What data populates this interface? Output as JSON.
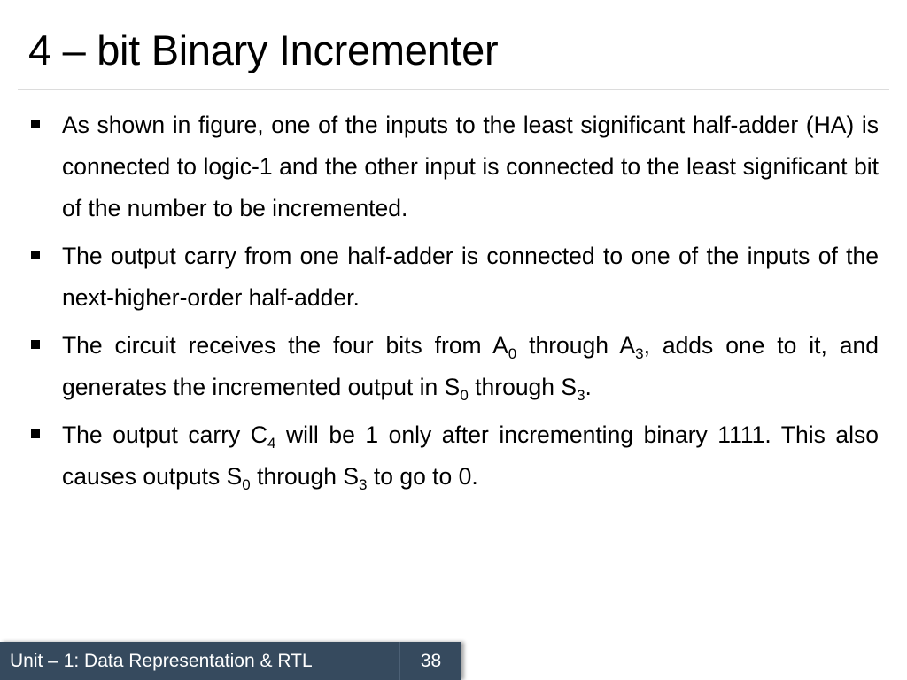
{
  "slide": {
    "title": "4 – bit Binary Incrementer",
    "bullets": [
      {
        "parts": [
          {
            "t": "As shown in figure, one of the inputs to the least significant half-adder (HA) is connected to logic-1 and the other input is connected to the least significant bit of the number to be incremented."
          }
        ]
      },
      {
        "parts": [
          {
            "t": " The output carry from one half-adder is connected to one of the inputs of the next-higher-order half-adder."
          }
        ]
      },
      {
        "parts": [
          {
            "t": "The circuit receives the four bits from A"
          },
          {
            "sub": "0"
          },
          {
            "t": " through A"
          },
          {
            "sub": "3"
          },
          {
            "t": ", adds one to it, and generates the incremented output in S"
          },
          {
            "sub": "0"
          },
          {
            "t": " through S"
          },
          {
            "sub": "3"
          },
          {
            "t": "."
          }
        ]
      },
      {
        "parts": [
          {
            "t": "The output carry C"
          },
          {
            "sub": "4"
          },
          {
            "t": " will be 1 only after incrementing binary 1111. This also causes outputs S"
          },
          {
            "sub": "0"
          },
          {
            "t": " through S"
          },
          {
            "sub": "3"
          },
          {
            "t": " to go to 0."
          }
        ]
      }
    ],
    "bullet_icon": "square-bullet-icon"
  },
  "footer": {
    "unit_label": "Unit – 1: Data Representation & RTL",
    "page_number": "38",
    "background_color": "#364a5e"
  }
}
